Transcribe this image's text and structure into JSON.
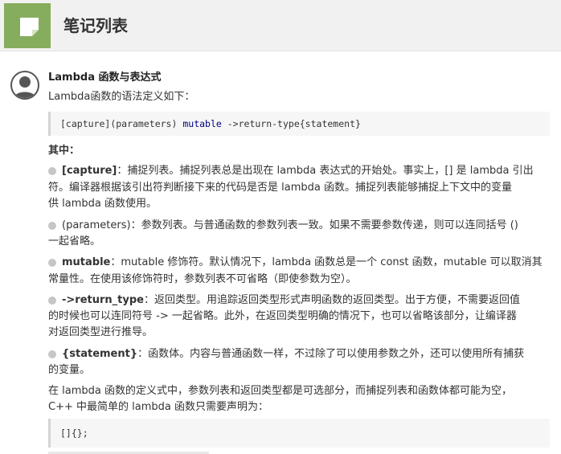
{
  "header": {
    "title": "笔记列表",
    "icon": "note-icon",
    "accent_color": "#86ad5d"
  },
  "note": {
    "title": "Lambda 函数与表达式",
    "intro": "Lambda函数的语法定义如下：",
    "syntax_code": {
      "capture": "[capture]",
      "params": "(parameters)",
      "mutable": "mutable",
      "rest": "->return-type{statement}"
    },
    "where_label": "其中：",
    "items": [
      {
        "label": "[capture]",
        "lines": [
          "：捕捉列表。捕捉列表总是出现在 lambda 表达式的开始处。事实上，[] 是 lambda 引出",
          "符。编译器根据该引出符判断接下来的代码是否是 lambda 函数。捕捉列表能够捕捉上下文中的变量",
          "供 lambda 函数使用。"
        ]
      },
      {
        "label": "(parameters)",
        "lines": [
          "：参数列表。与普通函数的参数列表一致。如果不需要参数传递，则可以连同括号 ()",
          "一起省略。"
        ]
      },
      {
        "label": "mutable",
        "lines": [
          "：mutable 修饰符。默认情况下，lambda 函数总是一个 const 函数，mutable 可以取消其",
          "常量性。在使用该修饰符时，参数列表不可省略（即使参数为空）。"
        ]
      },
      {
        "label": "->return_type",
        "lines": [
          "：返回类型。用追踪返回类型形式声明函数的返回类型。出于方便，不需要返回值",
          "的时候也可以连同符号 -> 一起省略。此外，在返回类型明确的情况下，也可以省略该部分，让编译器",
          "对返回类型进行推导。"
        ]
      },
      {
        "label": "{statement}",
        "lines": [
          "：函数体。内容与普通函数一样，不过除了可以使用参数之外，还可以使用所有捕获",
          "的变量。"
        ]
      }
    ],
    "summary_lines": [
      "在 lambda 函数的定义式中，参数列表和返回类型都是可选部分，而捕捉列表和函数体都可能为空，",
      "C++ 中最简单的 lambda 函数只需要声明为："
    ],
    "simplest_code": "[]{};"
  },
  "colors": {
    "keyword": "#000088",
    "code_bg": "#f6f6f6",
    "bullet": "#c6c6c6"
  }
}
